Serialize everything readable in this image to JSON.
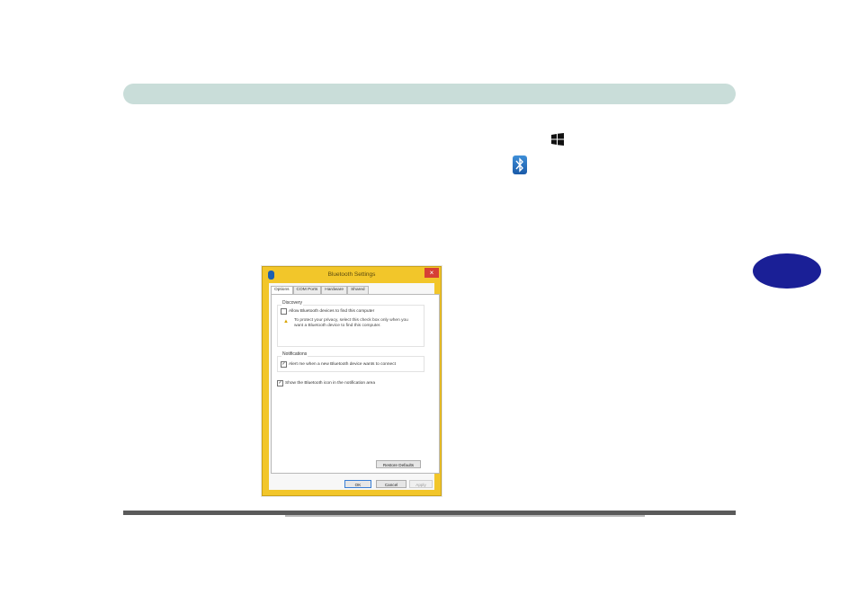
{
  "dialog": {
    "title": "Bluetooth Settings",
    "close_glyph": "×",
    "tabs": [
      {
        "label": "Options"
      },
      {
        "label": "COM Ports"
      },
      {
        "label": "Hardware"
      },
      {
        "label": "Shared"
      }
    ],
    "discovery": {
      "group_label": "Discovery",
      "allow_label": "Allow Bluetooth devices to find this computer",
      "allow_checked": false,
      "warning_text": "To protect your privacy, select this check box only when you want a Bluetooth device to find this computer."
    },
    "notifications": {
      "group_label": "Notifications",
      "alert_label": "Alert me when a new Bluetooth device wants to connect",
      "alert_checked": true
    },
    "show_icon_label": "Show the Bluetooth icon in the notification area",
    "show_icon_checked": true,
    "restore_defaults_label": "Restore Defaults",
    "ok_label": "OK",
    "cancel_label": "Cancel",
    "apply_label": "Apply"
  },
  "icons": {
    "windows_key": "windows-logo-icon",
    "bluetooth": "bluetooth-icon",
    "warning": "warning-icon"
  },
  "colors": {
    "header_band": "#c9ddd9",
    "chapter_tab": "#1a1f96",
    "dialog_frame": "#f2c62a",
    "close_button": "#d64035"
  }
}
